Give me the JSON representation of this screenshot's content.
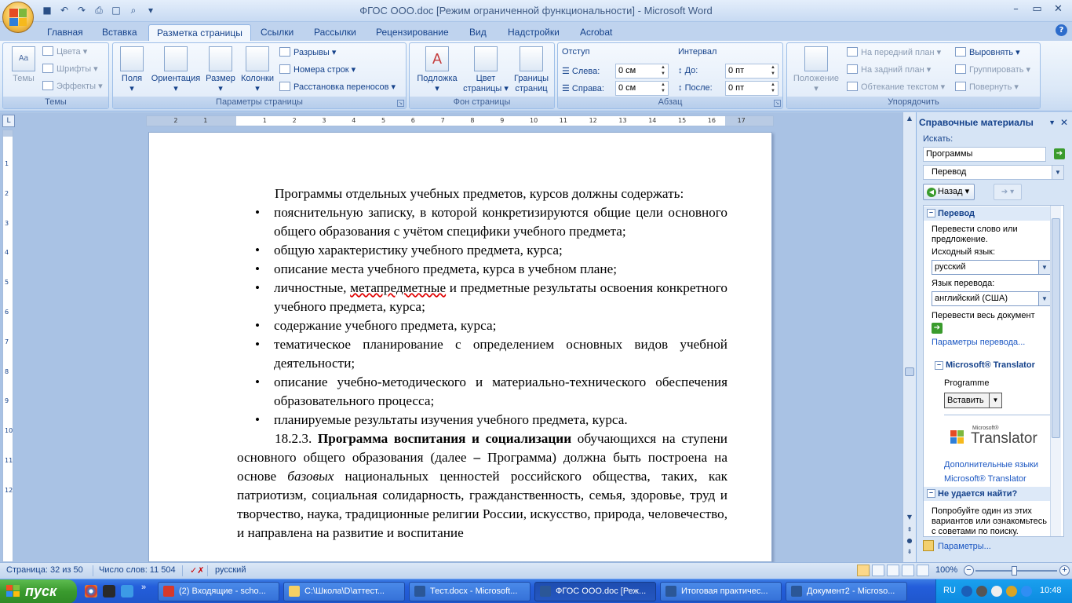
{
  "window": {
    "title": "ФГОС ООО.doc [Режим ограниченной функциональности] - Microsoft Word",
    "controls": [
      "–",
      "▭",
      "✕"
    ]
  },
  "quick_access": [
    "save-icon",
    "undo-icon",
    "redo-icon",
    "print-icon",
    "new-icon",
    "preview-icon"
  ],
  "tabs": [
    "Главная",
    "Вставка",
    "Разметка страницы",
    "Ссылки",
    "Рассылки",
    "Рецензирование",
    "Вид",
    "Надстройки",
    "Acrobat"
  ],
  "active_tab": "Разметка страницы",
  "ribbon": {
    "themes": {
      "label": "Темы",
      "themes_btn": "Темы",
      "colors": "Цвета",
      "fonts": "Шрифты",
      "effects": "Эффекты"
    },
    "page_setup": {
      "label": "Параметры страницы",
      "margins": "Поля",
      "orientation": "Ориентация",
      "size": "Размер",
      "columns": "Колонки",
      "breaks": "Разрывы",
      "line_numbers": "Номера строк",
      "hyphenation": "Расстановка переносов"
    },
    "page_background": {
      "label": "Фон страницы",
      "watermark": "Подложка",
      "page_color_1": "Цвет",
      "page_color_2": "страницы",
      "page_borders_1": "Границы",
      "page_borders_2": "страниц"
    },
    "paragraph": {
      "label": "Абзац",
      "indent_title": "Отступ",
      "left_label": "Слева:",
      "left_value": "0 см",
      "right_label": "Справа:",
      "right_value": "0 см",
      "spacing_title": "Интервал",
      "before_label": "До:",
      "before_value": "0 пт",
      "after_label": "После:",
      "after_value": "0 пт"
    },
    "arrange": {
      "label": "Упорядочить",
      "position": "Положение",
      "bring_front": "На передний план",
      "send_back": "На задний план",
      "text_wrap": "Обтекание текстом",
      "align": "Выровнять",
      "group": "Группировать",
      "rotate": "Повернуть"
    }
  },
  "document": {
    "intro": "Программы отдельных учебных предметов, курсов должны содержать:",
    "bullets": [
      "пояснительную записку, в которой конкретизируются общие цели основного общего образования с учётом специфики учебного предмета;",
      "общую характеристику учебного предмета, курса;",
      "описание места учебного предмета, курса в учебном плане;",
      "содержание учебного предмета, курса;",
      "тематическое планирование с определением основных видов учебной деятельности;",
      "описание учебно-методического и материально-технического обеспечения образовательного процесса;",
      "планируемые результаты изучения учебного предмета, курса."
    ],
    "bullet4_before": "личностные, ",
    "bullet4_spell": "метапредметные",
    "bullet4_after": " и предметные результаты освоения конкретного учебного предмета, курса;",
    "sec_num": "18.2.3. ",
    "sec_bold": "Программа воспитания и социализации",
    "sec_text1": " обучающихся на ступени основного общего образования (далее ",
    "sec_dash": "–",
    "sec_text2": " Программа) должна быть построена на основе ",
    "sec_italic": "базовых",
    "sec_text3": " национальных ценностей российского общества, таких, как патриотизм, социальная солидарность, гражданственность, семья, здоровье, труд и творчество, наука, традиционные религии России, искусство, природа, человечество, и направлена на развитие и воспитание"
  },
  "ruler": {
    "h_ticks": [
      "3",
      "2",
      "1",
      "1",
      "2",
      "3",
      "4",
      "5",
      "6",
      "7",
      "8",
      "9",
      "10",
      "11",
      "12",
      "13",
      "14",
      "15",
      "16",
      "17"
    ],
    "v_ticks": [
      "1",
      "2",
      "3",
      "4",
      "5",
      "6",
      "7",
      "8",
      "9",
      "10",
      "11",
      "12"
    ]
  },
  "task_pane": {
    "title": "Справочные материалы",
    "search_label": "Искать:",
    "search_value": "Программы",
    "service": "Перевод",
    "back": "Назад",
    "translate_head": "Перевод",
    "translate_desc_1": "Перевести слово или",
    "translate_desc_2": "предложение.",
    "source_label": "Исходный язык:",
    "source_value": "русский",
    "target_label": "Язык перевода:",
    "target_value": "английский (США)",
    "translate_doc": "Перевести весь документ",
    "translate_options": "Параметры перевода...",
    "ms_translator": "Microsoft® Translator",
    "result_word": "Programme",
    "insert": "Вставить",
    "logo_small": "Microsoft®",
    "logo_word": "Translator",
    "more_langs": "Дополнительные языки",
    "ms_translator_link": "Microsoft® Translator",
    "not_found_head": "Не удается найти?",
    "not_found_1": "Попробуйте один из этих",
    "not_found_2": "вариантов или ознакомьтесь",
    "not_found_3": "с советами по поиску.",
    "options_link": "Параметры..."
  },
  "status": {
    "page": "Страница: 32 из 50",
    "words": "Число слов: 11 504",
    "language": "русский",
    "zoom": "100%"
  },
  "taskbar": {
    "start": "пуск",
    "tasks": [
      "(2) Входящие - scho...",
      "C:\\Школа\\D\\аттест...",
      "Тест.docx - Microsoft...",
      "ФГОС ООО.doc [Реж...",
      "Итоговая практичес...",
      "Документ2 - Microso..."
    ],
    "active_task": 3,
    "lang": "RU",
    "clock": "10:48"
  },
  "colors": {
    "ribbon_text": "#15428b",
    "taskbar_blue": "#245edb",
    "start_green": "#3a9a2e",
    "tray_blue": "#0c8ae0"
  }
}
